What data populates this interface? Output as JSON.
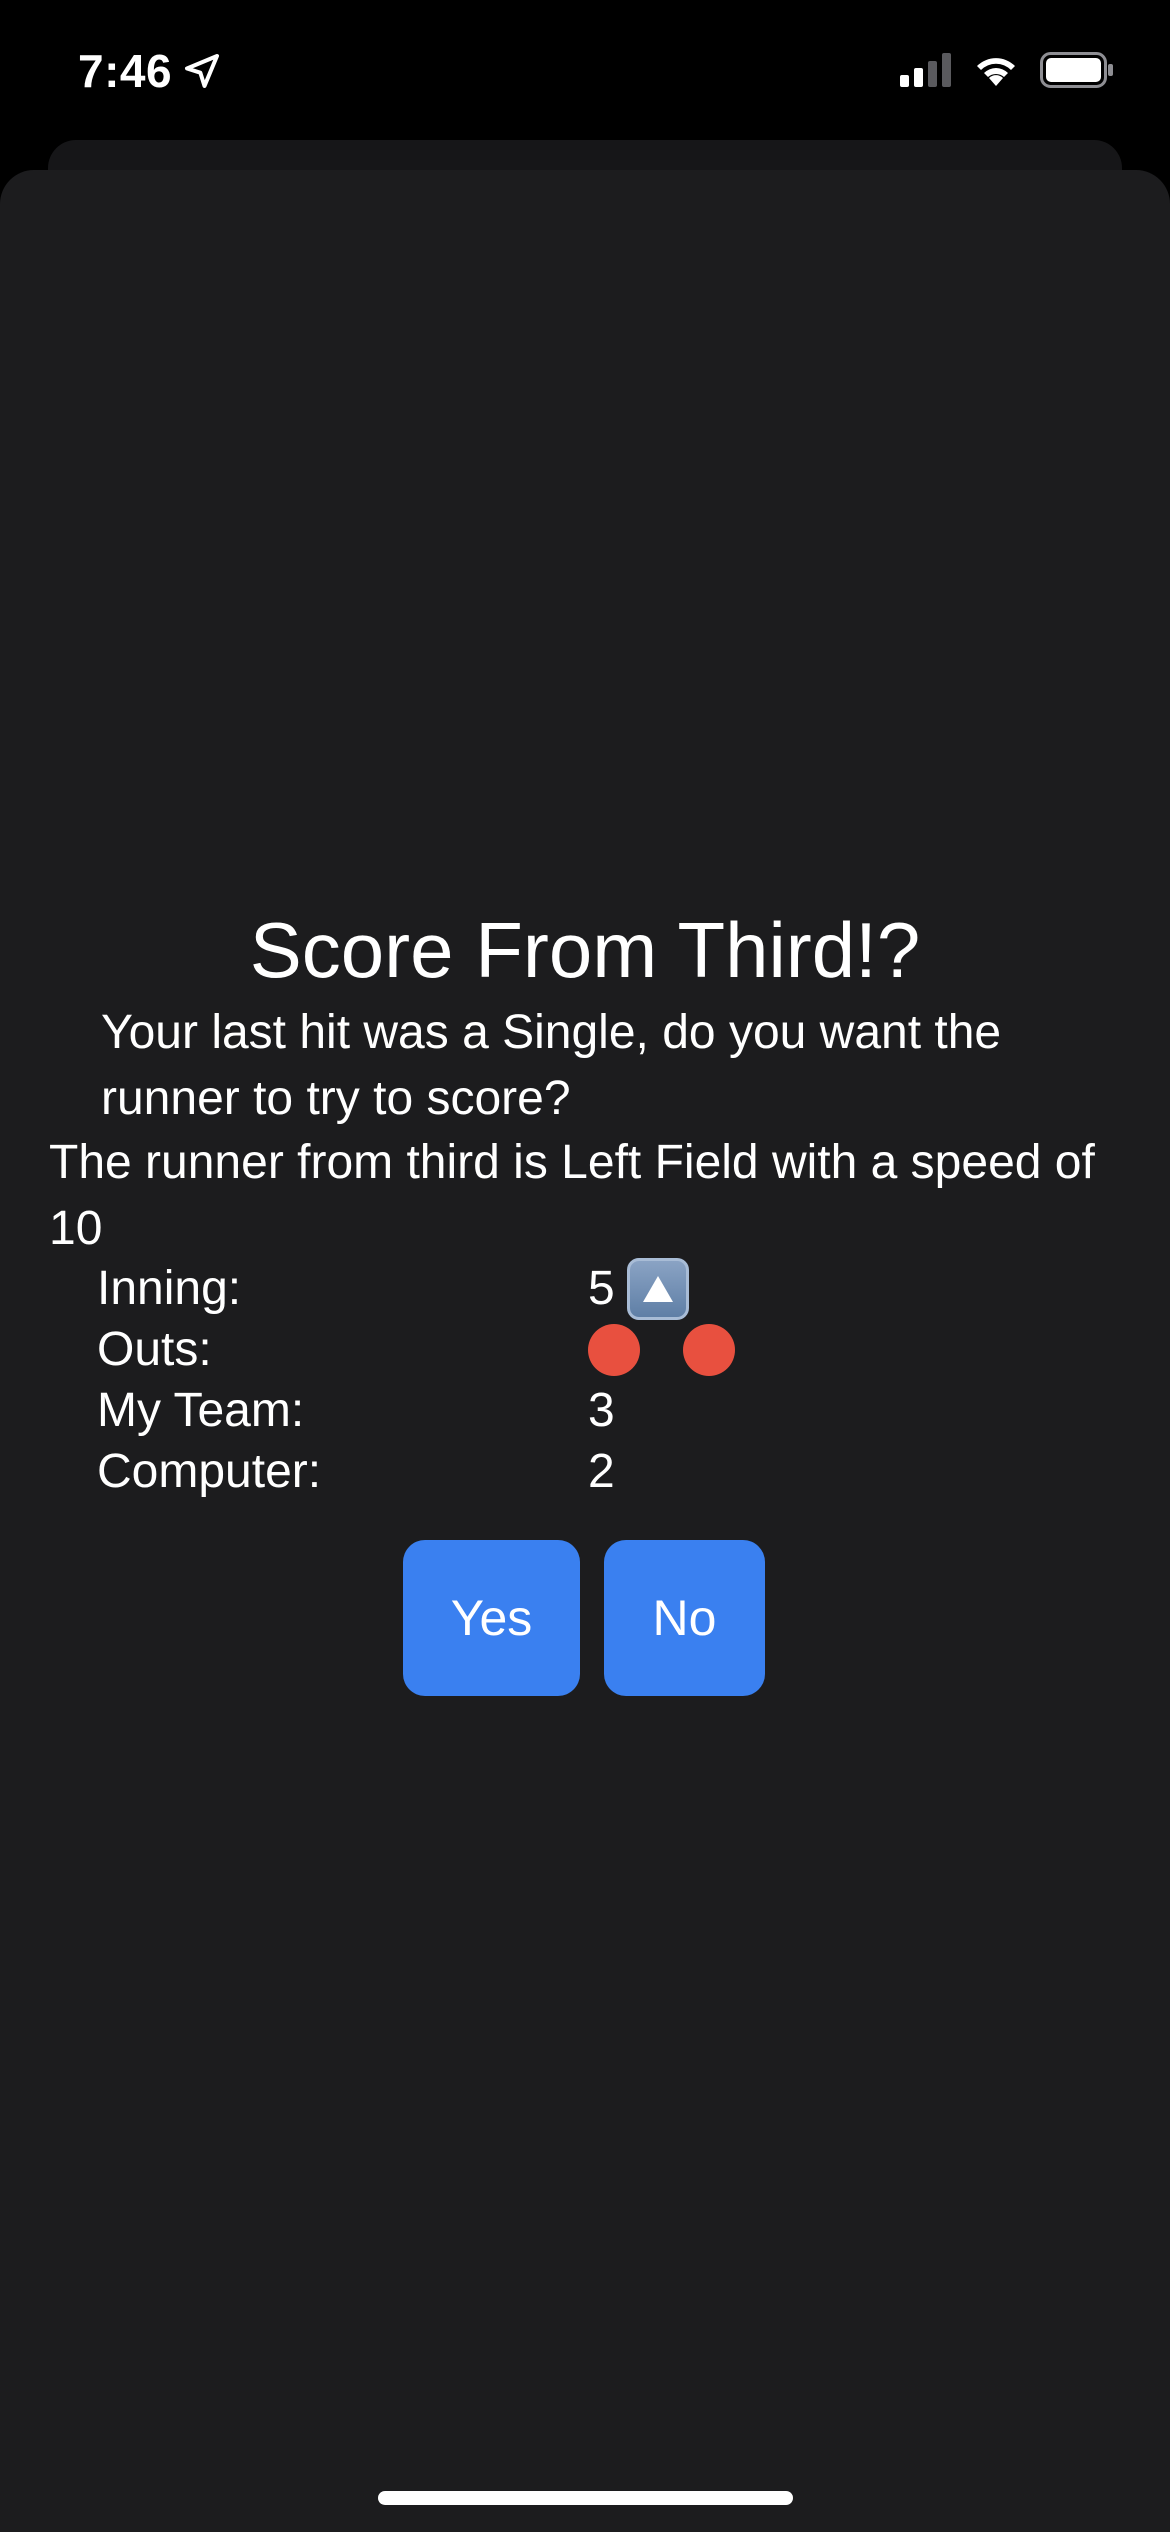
{
  "status_bar": {
    "time": "7:46",
    "icons": [
      "location-arrow-icon",
      "cellular-signal-icon",
      "wifi-icon",
      "battery-icon"
    ]
  },
  "dialog": {
    "title": "Score From Third!?",
    "question": "Your last hit was a Single, do you want the runner to try to score?",
    "runner_info": "The runner from third is Left Field with a speed of 10",
    "stats": {
      "inning_label": "Inning:",
      "inning_value": "5",
      "inning_half_icon": "up-arrow-icon",
      "outs_label": "Outs:",
      "outs_count": 2,
      "my_team_label": "My Team:",
      "my_team_value": "3",
      "computer_label": "Computer:",
      "computer_value": "2"
    },
    "buttons": {
      "yes_label": "Yes",
      "no_label": "No"
    }
  },
  "colors": {
    "background": "#000000",
    "sheet": "#1c1c1e",
    "button": "#3a80f0",
    "out_dot": "#e8503f",
    "text": "#ffffff"
  }
}
